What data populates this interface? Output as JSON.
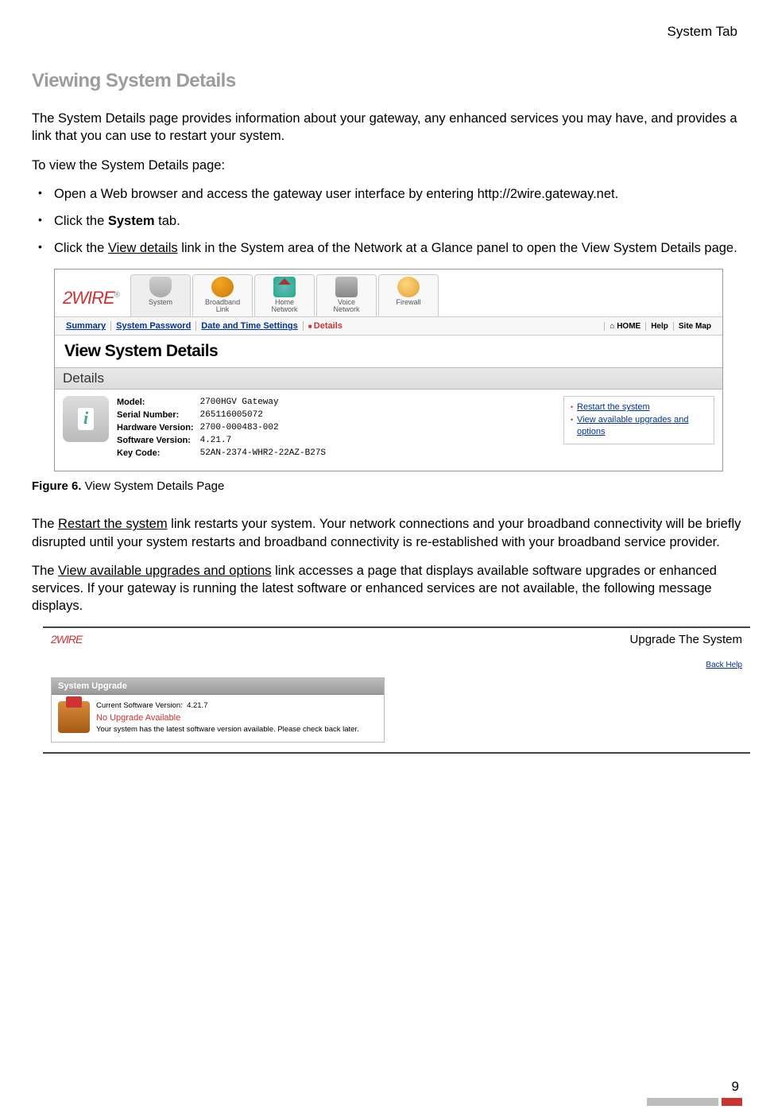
{
  "header_tab": "System Tab",
  "section_title": "Viewing System Details",
  "para_intro": "The System Details page provides information about your gateway, any enhanced services you may have, and provides a link that you can use to restart your system.",
  "para_toview": "To view the System Details page:",
  "step1": "Open a Web browser and access the gateway user interface by entering http://2wire.gateway.net.",
  "step2_pre": "Click the ",
  "step2_bold": "System",
  "step2_post": " tab.",
  "step3_pre": "Click the ",
  "step3_ul": "View details",
  "step3_post": " link in the System area of the Network at a Glance panel to open the View System Details page.",
  "fig1": {
    "logo": "2WIRE",
    "tabs": {
      "system": "System",
      "broadband": "Broadband\nLink",
      "home": "Home\nNetwork",
      "voice": "Voice\nNetwork",
      "firewall": "Firewall"
    },
    "subnav": {
      "summary": "Summary",
      "syspw": "System Password",
      "datetime": "Date and Time Settings",
      "details": "Details",
      "home": "HOME",
      "help": "Help",
      "sitemap": "Site Map"
    },
    "page_title": "View System Details",
    "details_label": "Details",
    "kv": {
      "model_k": "Model:",
      "model_v": "2700HGV Gateway",
      "serial_k": "Serial Number:",
      "serial_v": "265116005072",
      "hw_k": "Hardware Version:",
      "hw_v": "2700-000483-002",
      "sw_k": "Software Version:",
      "sw_v": "4.21.7",
      "key_k": "Key Code:",
      "key_v": "52AN-2374-WHR2-22AZ-B27S"
    },
    "side": {
      "restart": "Restart the system",
      "upgrades": "View available upgrades and options"
    }
  },
  "fig_caption_label": "Figure 6.",
  "fig_caption_text": " View System Details Page",
  "para_restart_pre": "The ",
  "para_restart_ul": "Restart the system",
  "para_restart_post": " link restarts your system. Your network connections and your broadband connectivity will be briefly disrupted until your system restarts and broadband connectivity is re-established with your broadband service provider.",
  "para_upgrade_pre": "The ",
  "para_upgrade_ul": "View available upgrades and options",
  "para_upgrade_post": " link accesses a page that displays available software upgrades or enhanced services. If your gateway is running the latest software or enhanced services are not available, the following message displays.",
  "fig2": {
    "logo": "2WIRE",
    "title": "Upgrade The System",
    "backhelp": "Back Help",
    "panel_title": "System Upgrade",
    "sv_label": "Current Software Version:",
    "sv_value": "4.21.7",
    "no_upgrade": "No Upgrade Available",
    "msg": "Your system has the latest software version available. Please check back later."
  },
  "page_number": "9"
}
